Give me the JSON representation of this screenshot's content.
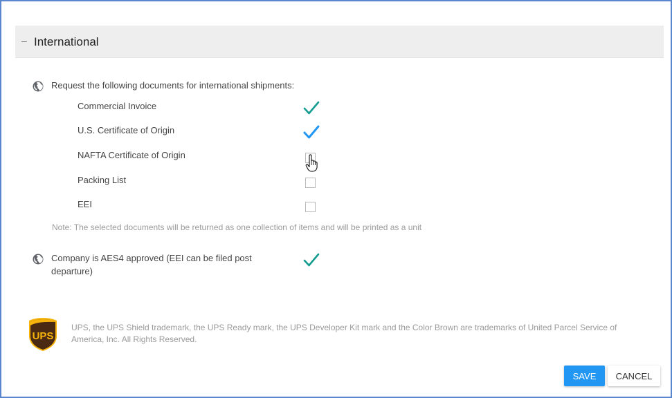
{
  "section": {
    "toggle_symbol": "–",
    "title": "International"
  },
  "documents_request": {
    "label": "Request the following documents for international shipments:",
    "icon": "globe-icon",
    "items": [
      {
        "label": "Commercial Invoice",
        "checked": true
      },
      {
        "label": "U.S. Certificate of Origin",
        "checked": true
      },
      {
        "label": "NAFTA Certificate of Origin",
        "checked": false
      },
      {
        "label": "Packing List",
        "checked": false
      },
      {
        "label": "EEI",
        "checked": false
      }
    ],
    "note": "Note: The selected documents will be returned as one collection of items and will be printed as a unit"
  },
  "aes4": {
    "label_line1": "Company is AES4 approved (EEI can be filed post",
    "label_line2": "departure)",
    "checked": true,
    "icon": "globe-icon"
  },
  "footer": {
    "logo_text": "UPS",
    "legal_text": "UPS, the UPS Shield trademark, the UPS Ready mark, the UPS Developer Kit mark and the Color Brown are trademarks of United Parcel Service of America, Inc. All Rights Reserved."
  },
  "buttons": {
    "save": "SAVE",
    "cancel": "CANCEL"
  },
  "colors": {
    "check_teal": "#129c8f",
    "check_blue": "#2196f3",
    "save_bg": "#2196f3",
    "frame_border": "#5b85d1",
    "ups_brown": "#4a2a12",
    "ups_gold": "#f6b30b"
  }
}
